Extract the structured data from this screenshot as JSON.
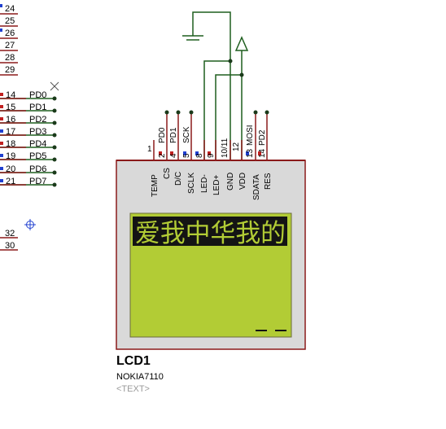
{
  "left_pins_top": [
    "24",
    "25",
    "26",
    "27",
    "28",
    "29"
  ],
  "left_ports": [
    {
      "num": "14",
      "label": "PD0",
      "color": "#c02020"
    },
    {
      "num": "15",
      "label": "PD1",
      "color": "#c02020"
    },
    {
      "num": "16",
      "label": "PD2",
      "color": "#c02020"
    },
    {
      "num": "17",
      "label": "PD3",
      "color": "#2040d0"
    },
    {
      "num": "18",
      "label": "PD4",
      "color": "#c02020"
    },
    {
      "num": "19",
      "label": "PD5",
      "color": "#2040d0"
    },
    {
      "num": "20",
      "label": "PD6",
      "color": "#2040d0"
    },
    {
      "num": "21",
      "label": "PD7",
      "color": "#2040d0"
    }
  ],
  "left_pins_bottom": [
    "32",
    "30"
  ],
  "lcd": {
    "ref": "LCD1",
    "part": "NOKIA7110",
    "text_placeholder": "<TEXT>",
    "screen_text": "爱我中华我的",
    "screen_color": "#b2cc35",
    "body_color": "#d9d9d9",
    "border_color": "#8b1a1a",
    "pins": [
      {
        "num": "1",
        "name": "TEMP",
        "net": "",
        "color": ""
      },
      {
        "num": "2",
        "name": "CS",
        "net": "PD0",
        "color": "#c02020"
      },
      {
        "num": "4",
        "name": "D/C",
        "net": "PD1",
        "color": "#c02020"
      },
      {
        "num": "5",
        "name": "SCLK",
        "net": "SCK",
        "color": "#2040d0"
      },
      {
        "num": "8",
        "name": "LED-",
        "net": "",
        "color": "#2040d0"
      },
      {
        "num": "9",
        "name": "LED+",
        "net": "",
        "color": "#c02020"
      },
      {
        "num": "10/11",
        "name": "GND",
        "net": "",
        "color": ""
      },
      {
        "num": "12",
        "name": "VDD",
        "net": "",
        "color": ""
      },
      {
        "num": "13",
        "name": "SDATA",
        "net": "MOSI",
        "color": "#2040d0"
      },
      {
        "num": "14",
        "name": "RES",
        "net": "PD2",
        "color": "#c02020"
      }
    ]
  },
  "colors": {
    "wire": "#1f5f1f",
    "junction": "#1a3a1a",
    "pin_text": "#000000",
    "pin_line": "#8b1a1a"
  }
}
